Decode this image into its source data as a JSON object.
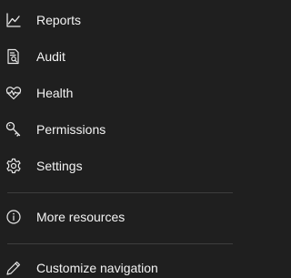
{
  "nav": {
    "items": [
      {
        "label": "Reports",
        "icon": "chart-line-icon"
      },
      {
        "label": "Audit",
        "icon": "document-search-icon"
      },
      {
        "label": "Health",
        "icon": "heart-pulse-icon"
      },
      {
        "label": "Permissions",
        "icon": "key-icon"
      },
      {
        "label": "Settings",
        "icon": "gear-icon"
      }
    ],
    "more": {
      "label": "More resources",
      "icon": "info-icon"
    },
    "customize": {
      "label": "Customize navigation",
      "icon": "pencil-icon"
    }
  },
  "colors": {
    "background": "#1f1f1f",
    "text": "#f3f3f3",
    "divider": "#3d3d3d"
  }
}
